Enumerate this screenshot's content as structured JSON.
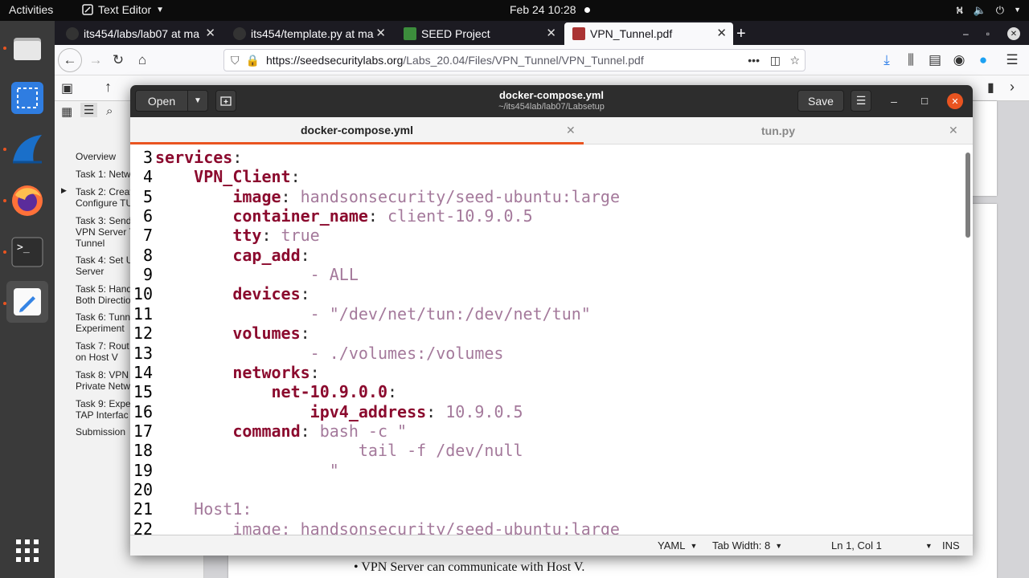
{
  "topbar": {
    "activities": "Activities",
    "app_menu": "Text Editor",
    "clock": "Feb 24  10:28"
  },
  "dock": {
    "items": [
      {
        "name": "files"
      },
      {
        "name": "screenshot"
      },
      {
        "name": "wireshark"
      },
      {
        "name": "firefox"
      },
      {
        "name": "terminal"
      },
      {
        "name": "text-editor"
      }
    ]
  },
  "browser": {
    "tabs": [
      {
        "label": "its454/labs/lab07 at ma",
        "close": "✕"
      },
      {
        "label": "its454/template.py at ma",
        "close": "✕"
      },
      {
        "label": "SEED Project",
        "close": "✕"
      },
      {
        "label": "VPN_Tunnel.pdf",
        "close": "✕"
      }
    ],
    "new_tab": "+",
    "url_host": "https://seedsecuritylabs.org",
    "url_path": "/Labs_20.04/Files/VPN_Tunnel/VPN_Tunnel.pdf",
    "url_more": "•••"
  },
  "pdf": {
    "outline": [
      "Overview",
      "Task 1: Netw",
      "Task 2: Creat\nConfigure TU",
      "Task 3: Send\nVPN Server T\nTunnel",
      "Task 4: Set U\nServer",
      "Task 5: Hand\nBoth Directio",
      "Task 6: Tunn\nExperiment",
      "Task 7: Rout\non Host V",
      "Task 8: VPN\nPrivate Netw",
      "Task 9: Expe\nTAP Interfac",
      "Submission"
    ],
    "body_text": "•  VPN Server can communicate with Host V."
  },
  "editor": {
    "open_label": "Open",
    "save_label": "Save",
    "title": "docker-compose.yml",
    "subtitle": "~/its454lab/lab07/Labsetup",
    "tabs": [
      {
        "label": "docker-compose.yml",
        "close": "✕"
      },
      {
        "label": "tun.py",
        "close": "✕"
      }
    ],
    "lines": [
      {
        "n": "3",
        "key": "services",
        "colon": ":",
        "val": ""
      },
      {
        "n": "4",
        "key": "    VPN_Client",
        "colon": ":",
        "val": ""
      },
      {
        "n": "5",
        "key": "        image",
        "colon": ":",
        "val": " handsonsecurity/seed-ubuntu:large"
      },
      {
        "n": "6",
        "key": "        container_name",
        "colon": ":",
        "val": " client-10.9.0.5"
      },
      {
        "n": "7",
        "key": "        tty",
        "colon": ":",
        "val": " true"
      },
      {
        "n": "8",
        "key": "        cap_add",
        "colon": ":",
        "val": ""
      },
      {
        "n": "9",
        "key": "",
        "colon": "",
        "val": "                - ALL"
      },
      {
        "n": "10",
        "key": "        devices",
        "colon": ":",
        "val": ""
      },
      {
        "n": "11",
        "key": "",
        "colon": "",
        "val": "                - \"/dev/net/tun:/dev/net/tun\""
      },
      {
        "n": "12",
        "key": "        volumes",
        "colon": ":",
        "val": ""
      },
      {
        "n": "13",
        "key": "",
        "colon": "",
        "val": "                - ./volumes:/volumes"
      },
      {
        "n": "14",
        "key": "        networks",
        "colon": ":",
        "val": ""
      },
      {
        "n": "15",
        "key": "            net-10.9.0.0",
        "colon": ":",
        "val": ""
      },
      {
        "n": "16",
        "key": "                ipv4_address",
        "colon": ":",
        "val": " 10.9.0.5"
      },
      {
        "n": "17",
        "key": "        command",
        "colon": ":",
        "val": " bash -c \""
      },
      {
        "n": "18",
        "key": "",
        "colon": "",
        "val": "                     tail -f /dev/null"
      },
      {
        "n": "19",
        "key": "",
        "colon": "",
        "val": "                  \""
      },
      {
        "n": "20",
        "key": "",
        "colon": "",
        "val": ""
      },
      {
        "n": "21",
        "key": "",
        "colon": "",
        "val": "    Host1:"
      },
      {
        "n": "22",
        "key": "",
        "colon": "",
        "val": "        image: handsonsecurity/seed-ubuntu:large"
      }
    ],
    "status": {
      "language": "YAML",
      "tab_width": "Tab Width: 8",
      "position": "Ln 1, Col 1",
      "mode": "INS"
    }
  },
  "colors": {
    "key": "#8b0a2e",
    "value": "#a4799b",
    "accent": "#e95420"
  }
}
